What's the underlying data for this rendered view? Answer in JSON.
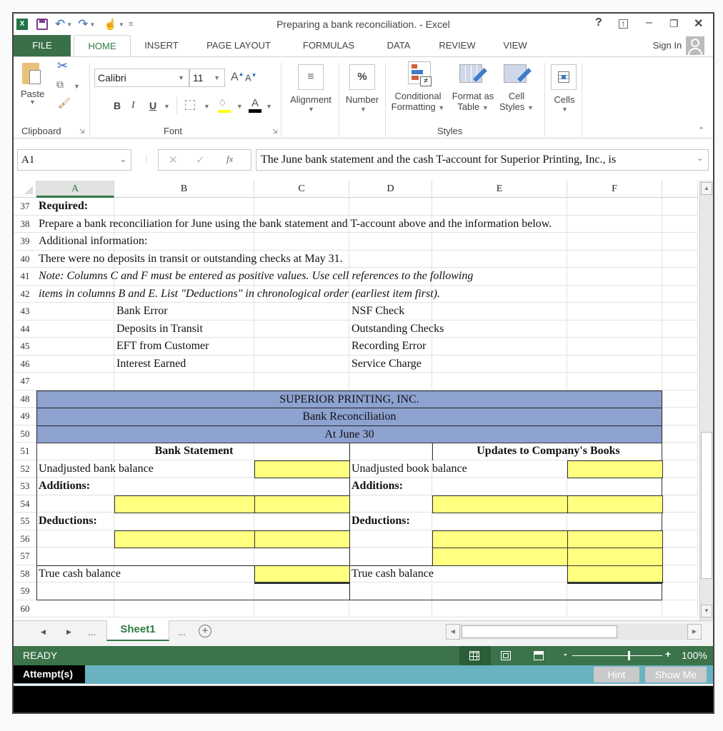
{
  "app": {
    "title": "Preparing a bank reconciliation. - Excel",
    "help": "?",
    "sign_in": "Sign In"
  },
  "ribbon_tabs": [
    "FILE",
    "HOME",
    "INSERT",
    "PAGE LAYOUT",
    "FORMULAS",
    "DATA",
    "REVIEW",
    "VIEW"
  ],
  "ribbon": {
    "paste": "Paste",
    "clipboard": "Clipboard",
    "font_name": "Calibri",
    "font_size": "11",
    "font": "Font",
    "bold": "B",
    "italic": "I",
    "underline": "U",
    "alignment": "Alignment",
    "number": "Number",
    "conditional_1": "Conditional",
    "conditional_2": "Formatting",
    "format_table_1": "Format as",
    "format_table_2": "Table",
    "cell_styles_1": "Cell",
    "cell_styles_2": "Styles",
    "styles": "Styles",
    "cells": "Cells",
    "percent": "%"
  },
  "formula_bar": {
    "name_box": "A1",
    "fx": "fx",
    "content": "The June bank statement and the cash T-account for Superior Printing, Inc., is"
  },
  "columns": [
    "A",
    "B",
    "C",
    "D",
    "E",
    "F"
  ],
  "rows": [
    "37",
    "38",
    "39",
    "40",
    "41",
    "42",
    "43",
    "44",
    "45",
    "46",
    "47",
    "48",
    "49",
    "50",
    "51",
    "52",
    "53",
    "54",
    "55",
    "56",
    "57",
    "58",
    "59",
    "60"
  ],
  "cells": {
    "r37": "Required:",
    "r38": "Prepare a bank reconciliation for June using the bank statement and T-account above and the information below.",
    "r39": "Additional information:",
    "r40": "There were no deposits in transit or outstanding checks at May 31.",
    "r41": "Note: Columns C and F must be entered as positive values.  Use cell references to the following",
    "r42": "items in columns B and E.  List \"Deductions\" in chronological order (earliest item first).",
    "items_b": [
      "Bank Error",
      "Deposits in Transit",
      "EFT from Customer",
      "Interest Earned"
    ],
    "items_d": [
      "NSF Check",
      "Outstanding Checks",
      "Recording Error",
      "Service Charge"
    ],
    "company": "SUPERIOR PRINTING, INC.",
    "report": "Bank Reconciliation",
    "date": "At June 30",
    "bank_header": "Bank Statement",
    "books_header": "Updates to Company's Books",
    "unadj_bank": "Unadjusted bank balance",
    "unadj_book": "Unadjusted book balance",
    "additions": "Additions:",
    "deductions": "Deductions:",
    "true_cash": "True cash balance"
  },
  "sheet": {
    "active_tab": "Sheet1",
    "ellipsis": "..."
  },
  "status": {
    "ready": "READY",
    "zoom": "100%",
    "zoom_percent": 100
  },
  "attempt_bar": {
    "label": "Attempt(s)",
    "hint": "Hint",
    "show_me": "Show Me"
  }
}
